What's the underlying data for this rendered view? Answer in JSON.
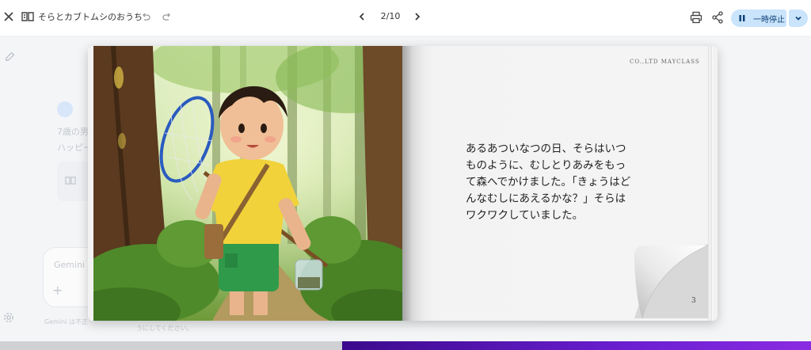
{
  "toolbar": {
    "title": "そらとカブトムシのおうち",
    "page_indicator": "2/10",
    "pause_label": "一時停止",
    "icons": {
      "close": "close-icon",
      "book": "book-icon",
      "undo": "undo-icon",
      "redo": "redo-icon",
      "prev": "chevron-left-icon",
      "next": "chevron-right-icon",
      "print": "print-icon",
      "share": "share-icon",
      "pause": "pause-icon",
      "dropdown": "chevron-down-icon"
    },
    "accent_color": "#c9e4fb"
  },
  "background_chat": {
    "message_line_1": "7歳の男",
    "message_line_2": "ハッピー",
    "input_placeholder": "Gemini に",
    "plus_label": "+",
    "disclaimer_1": "Gemini は不正",
    "disclaimer_2": "うにしてください。"
  },
  "book": {
    "publisher": "CO.,LTD MAYCLASS",
    "story_lines": [
      "あるあついなつの日、そらはいつ",
      "ものように、むしとりあみをもっ",
      "て森へでかけました。「きょうはど",
      "んなむしにあえるかな？」そらは",
      "ワクワクしていました。"
    ],
    "page_number": "3"
  }
}
